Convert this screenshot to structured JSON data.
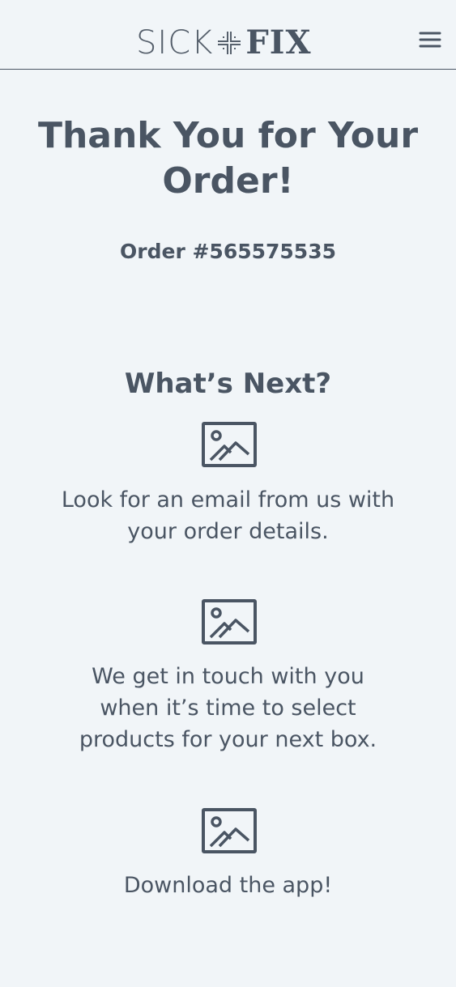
{
  "header": {
    "logo_sick": "SICK",
    "logo_fix": "FIX",
    "menu_icon": "hamburger-menu-icon"
  },
  "main": {
    "title": "Thank You for Your Order!",
    "order_number": "Order #565575535",
    "next_heading": "What’s Next?",
    "steps": [
      {
        "icon": "image-placeholder-icon",
        "text": "Look for an email from us with your order details."
      },
      {
        "icon": "image-placeholder-icon",
        "text": "We get in touch with you when it’s time to select products for your next box."
      },
      {
        "icon": "image-placeholder-icon",
        "text": "Download the app!"
      }
    ]
  },
  "colors": {
    "background": "#f1f5f8",
    "text": "#4a5563"
  }
}
